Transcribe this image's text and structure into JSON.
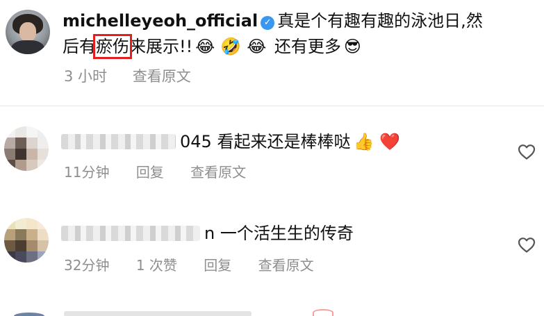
{
  "post": {
    "username": "michelleyeoh_official",
    "caption_line1_text": "真是个有趣有趣的泳池日,然",
    "caption_line2_before": "后有",
    "caption_highlight": "瘀伤",
    "caption_line2_after": "来展示!!",
    "emojis": [
      "😂",
      "🤣",
      "😂"
    ],
    "caption_more": "还有更多",
    "emoji_end": "😎",
    "time": "3 小时",
    "see_translation": "查看原文"
  },
  "comments": [
    {
      "username_visible": "045",
      "text": "看起来还是棒棒哒",
      "emojis": [
        "👍",
        "❤️"
      ],
      "time": "11分钟",
      "reply": "回复",
      "see_translation": "查看原文"
    },
    {
      "username_visible": "n",
      "text": "一个活生生的传奇",
      "time": "32分钟",
      "likes": "1 次赞",
      "reply": "回复",
      "see_translation": "查看原文"
    }
  ],
  "colors": {
    "verified": "#3897f0",
    "highlight_box": "#e02020",
    "meta_text": "#8e8e8e"
  },
  "icons": [
    "verified-badge-icon",
    "heart-outline-icon"
  ]
}
